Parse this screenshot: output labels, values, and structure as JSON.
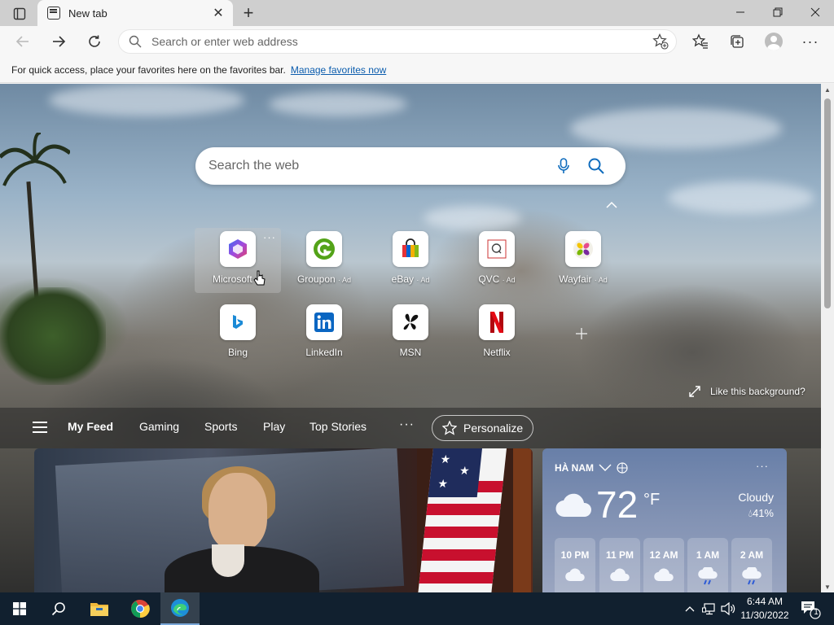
{
  "tab": {
    "title": "New tab"
  },
  "window_controls": {
    "minimize": "—",
    "maximize": "❐",
    "close": "✕"
  },
  "address_bar": {
    "placeholder": "Search or enter web address",
    "value": ""
  },
  "favorites_bar": {
    "message": "For quick access, place your favorites here on the favorites bar.",
    "link": "Manage favorites now"
  },
  "search": {
    "placeholder": "Search the web"
  },
  "quick_links": [
    {
      "label": "Microsoft ...",
      "ad": ""
    },
    {
      "label": "Groupon",
      "ad": "· Ad"
    },
    {
      "label": "eBay",
      "ad": "· Ad"
    },
    {
      "label": "QVC",
      "ad": "· Ad"
    },
    {
      "label": "Wayfair",
      "ad": "· Ad"
    },
    {
      "label": "Bing",
      "ad": ""
    },
    {
      "label": "LinkedIn",
      "ad": ""
    },
    {
      "label": "MSN",
      "ad": ""
    },
    {
      "label": "Netflix",
      "ad": ""
    }
  ],
  "like_background": "Like this background?",
  "feed_nav": {
    "tabs": [
      "My Feed",
      "Gaming",
      "Sports",
      "Play",
      "Top Stories"
    ],
    "more": "···",
    "personalize": "Personalize"
  },
  "weather": {
    "location": "HÀ NAM",
    "temperature": "72",
    "unit": "°F",
    "condition": "Cloudy",
    "humidity": "41%",
    "more": "···",
    "hourly": [
      {
        "time": "10 PM",
        "icon": "cloud-icon"
      },
      {
        "time": "11 PM",
        "icon": "cloud-icon"
      },
      {
        "time": "12 AM",
        "icon": "cloud-icon"
      },
      {
        "time": "1 AM",
        "icon": "cloud-rain-icon"
      },
      {
        "time": "2 AM",
        "icon": "cloud-rain-icon"
      }
    ]
  },
  "taskbar": {
    "clock_time": "6:44 AM",
    "clock_date": "11/30/2022",
    "notification_count": "1"
  },
  "colors": {
    "accent_link": "#0b5cad",
    "taskbar_bg": "#11202f",
    "tab_strip_bg": "#cfcfcf"
  }
}
